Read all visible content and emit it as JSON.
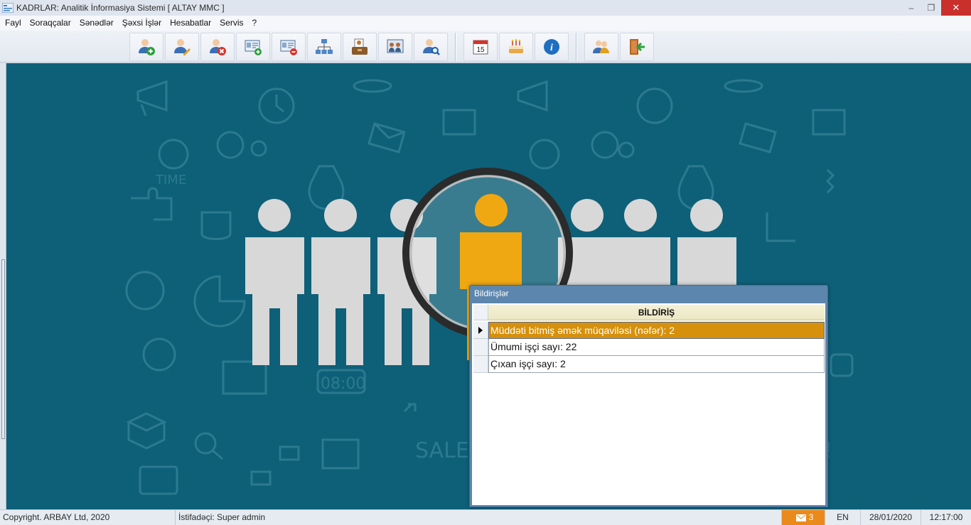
{
  "window": {
    "title": "KADRLAR: Analitik İnformasiya Sistemi [ ALTAY MMC ]",
    "minimize": "–",
    "restore": "❐",
    "close": "✕"
  },
  "menu": {
    "items": [
      "Fayl",
      "Soraqçalar",
      "Sənədlər",
      "Şəxsi İşlər",
      "Hesabatlar",
      "Servis",
      "?"
    ]
  },
  "toolbar": {
    "buttons": [
      {
        "icon": "add-user-icon"
      },
      {
        "icon": "edit-user-icon"
      },
      {
        "icon": "delete-user-icon"
      },
      {
        "icon": "add-card-icon"
      },
      {
        "icon": "remove-card-icon"
      },
      {
        "icon": "org-structure-icon"
      },
      {
        "icon": "briefcase-document-icon"
      },
      {
        "icon": "staff-board-icon"
      },
      {
        "icon": "search-user-icon"
      },
      {
        "icon": "calendar-icon",
        "text": "15"
      },
      {
        "icon": "birthday-cake-icon"
      },
      {
        "icon": "info-icon",
        "text": "i"
      },
      {
        "icon": "users-key-icon"
      },
      {
        "icon": "exit-door-icon"
      }
    ]
  },
  "dialog": {
    "title": "Bildirişlər",
    "column_header": "BİLDİRİŞ",
    "rows": [
      {
        "text": "Müddəti bitmiş əmək müqaviləsi (nəfər): 2",
        "selected": true
      },
      {
        "text": "Ümumi işçi sayı: 22",
        "selected": false
      },
      {
        "text": "Çıxan işçi sayı: 2",
        "selected": false
      }
    ]
  },
  "statusbar": {
    "copyright": "Copyright. ARBAY Ltd, 2020",
    "user": "İstifadəçi: Super admin",
    "notifications_count": "3",
    "language": "EN",
    "date": "28/01/2020",
    "time": "12:17:00"
  },
  "colors": {
    "background": "#0e6078",
    "selected_row": "#d6900b",
    "highlight_person": "#f0a812",
    "person": "#d8d8d8",
    "notification_badge": "#e98a1b"
  }
}
